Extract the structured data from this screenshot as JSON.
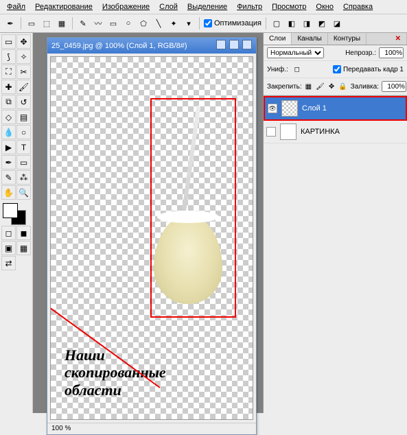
{
  "menu": [
    "Файл",
    "Редактирование",
    "Изображение",
    "Слой",
    "Выделение",
    "Фильтр",
    "Просмотр",
    "Окно",
    "Справка"
  ],
  "optimize_label": "Оптимизация",
  "doc_title": "25_0459.jpg @ 100% (Слой 1, RGB/8#)",
  "zoom": "100 %",
  "panel": {
    "tabs": [
      "Слои",
      "Каналы",
      "Контуры"
    ],
    "blend_mode": "Нормальный",
    "opacity_lbl": "Непрозр.:",
    "opacity": "100%",
    "unif_lbl": "Униф.:",
    "pass_frame": "Передавать кадр 1",
    "lock_lbl": "Закрепить:",
    "fill_lbl": "Заливка:",
    "fill": "100%"
  },
  "layers": [
    {
      "name": "Слой 1",
      "selected": true,
      "visible": true
    },
    {
      "name": "КАРТИНКА",
      "selected": false,
      "visible": false
    }
  ],
  "annotation": "Наши\nскопированные\nобласти"
}
